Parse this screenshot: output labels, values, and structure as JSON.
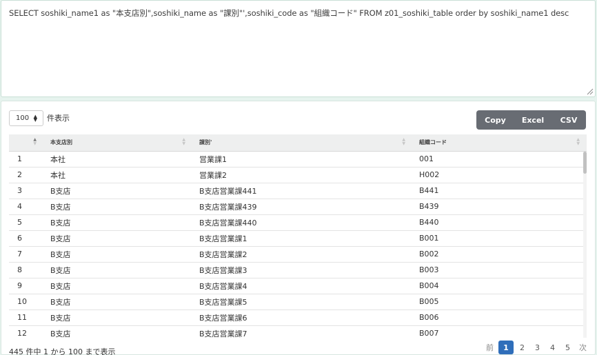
{
  "query": {
    "text": "SELECT soshiki_name1 as \"本支店別\",soshiki_name as \"課別\"',soshiki_code as \"組織コード\" FROM z01_soshiki_table order by soshiki_name1 desc"
  },
  "length": {
    "value": "100",
    "label": "件表示"
  },
  "buttons": {
    "copy": "Copy",
    "excel": "Excel",
    "csv": "CSV"
  },
  "columns": [
    "本支店別",
    "課別'",
    "組織コード"
  ],
  "rows": [
    [
      "1",
      "本社",
      "営業課1",
      "001"
    ],
    [
      "2",
      "本社",
      "営業課2",
      "H002"
    ],
    [
      "3",
      "B支店",
      "B支店営業課441",
      "B441"
    ],
    [
      "4",
      "B支店",
      "B支店営業課439",
      "B439"
    ],
    [
      "5",
      "B支店",
      "B支店営業課440",
      "B440"
    ],
    [
      "6",
      "B支店",
      "B支店営業課1",
      "B001"
    ],
    [
      "7",
      "B支店",
      "B支店営業課2",
      "B002"
    ],
    [
      "8",
      "B支店",
      "B支店営業課3",
      "B003"
    ],
    [
      "9",
      "B支店",
      "B支店営業課4",
      "B004"
    ],
    [
      "10",
      "B支店",
      "B支店営業課5",
      "B005"
    ],
    [
      "11",
      "B支店",
      "B支店営業課6",
      "B006"
    ],
    [
      "12",
      "B支店",
      "B支店営業課7",
      "B007"
    ]
  ],
  "info": "445 件中 1 から 100 まで表示",
  "pagination": {
    "prev": "前",
    "pages": [
      "1",
      "2",
      "3",
      "4",
      "5"
    ],
    "current": "1",
    "next": "次"
  }
}
